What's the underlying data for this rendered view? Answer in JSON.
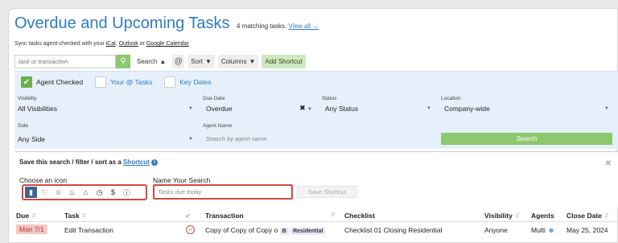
{
  "header": {
    "title": "Overdue and Upcoming Tasks",
    "count_text": "4 matching tasks.",
    "view_all": "View all →"
  },
  "sync": {
    "prefix": "Sync tasks agent-checked with your",
    "ical": "iCal",
    "sep1": ",",
    "outlook": "Outlook",
    "or": "or",
    "google": "Google Calendar"
  },
  "toolbar": {
    "search_placeholder": "task or transaction",
    "search_label": "Search",
    "at_label": "@",
    "sort_label": "Sort",
    "columns_label": "Columns",
    "add_shortcut_label": "Add Shortcut"
  },
  "filters": {
    "agent_checked_label": "Agent Checked",
    "your_tasks_label": "Your @ Tasks",
    "key_dates_label": "Key Dates",
    "visibility_label": "Visibility",
    "visibility_value": "All Visibilities",
    "due_date_label": "Due Date",
    "due_date_value": "Overdue",
    "status_label": "Status",
    "status_value": "Any Status",
    "location_label": "Location",
    "location_value": "Company-wide",
    "side_label": "Side",
    "side_value": "Any Side",
    "agent_name_label": "Agent Name",
    "agent_name_placeholder": "Search by agent name",
    "search_button": "Search"
  },
  "save": {
    "title_prefix": "Save this search / filter / sort as a",
    "shortcut_link": "Shortcut",
    "choose_icon_label": "Choose an icon",
    "name_label": "Name Your Search",
    "name_placeholder": "Tasks due today",
    "save_button": "Save Shortcut",
    "icons": [
      "bookmark-icon",
      "heart-icon",
      "star-icon",
      "bell-icon",
      "home-icon",
      "clock-icon",
      "dollar-icon",
      "alert-icon"
    ]
  },
  "table": {
    "headers": {
      "due": "Due",
      "task": "Task",
      "transaction": "Transaction",
      "checklist": "Checklist",
      "visibility": "Visibility",
      "agents": "Agents",
      "close_date": "Close Date"
    },
    "rows": [
      {
        "due": "Mon 7/1",
        "task": "Edit Transaction",
        "transaction": "Copy of Copy of Copy o",
        "tag_b": "B",
        "tag_type": "Residential",
        "checklist": "Checklist 01 Closing Residential",
        "visibility": "Anyone",
        "agents": "Multi",
        "close_date": "May 25, 2024"
      }
    ]
  },
  "colors": {
    "accent": "#2f7bbf",
    "green": "#8cc86c",
    "filter_bg": "#e6f0fa",
    "highlight": "#d04848"
  }
}
